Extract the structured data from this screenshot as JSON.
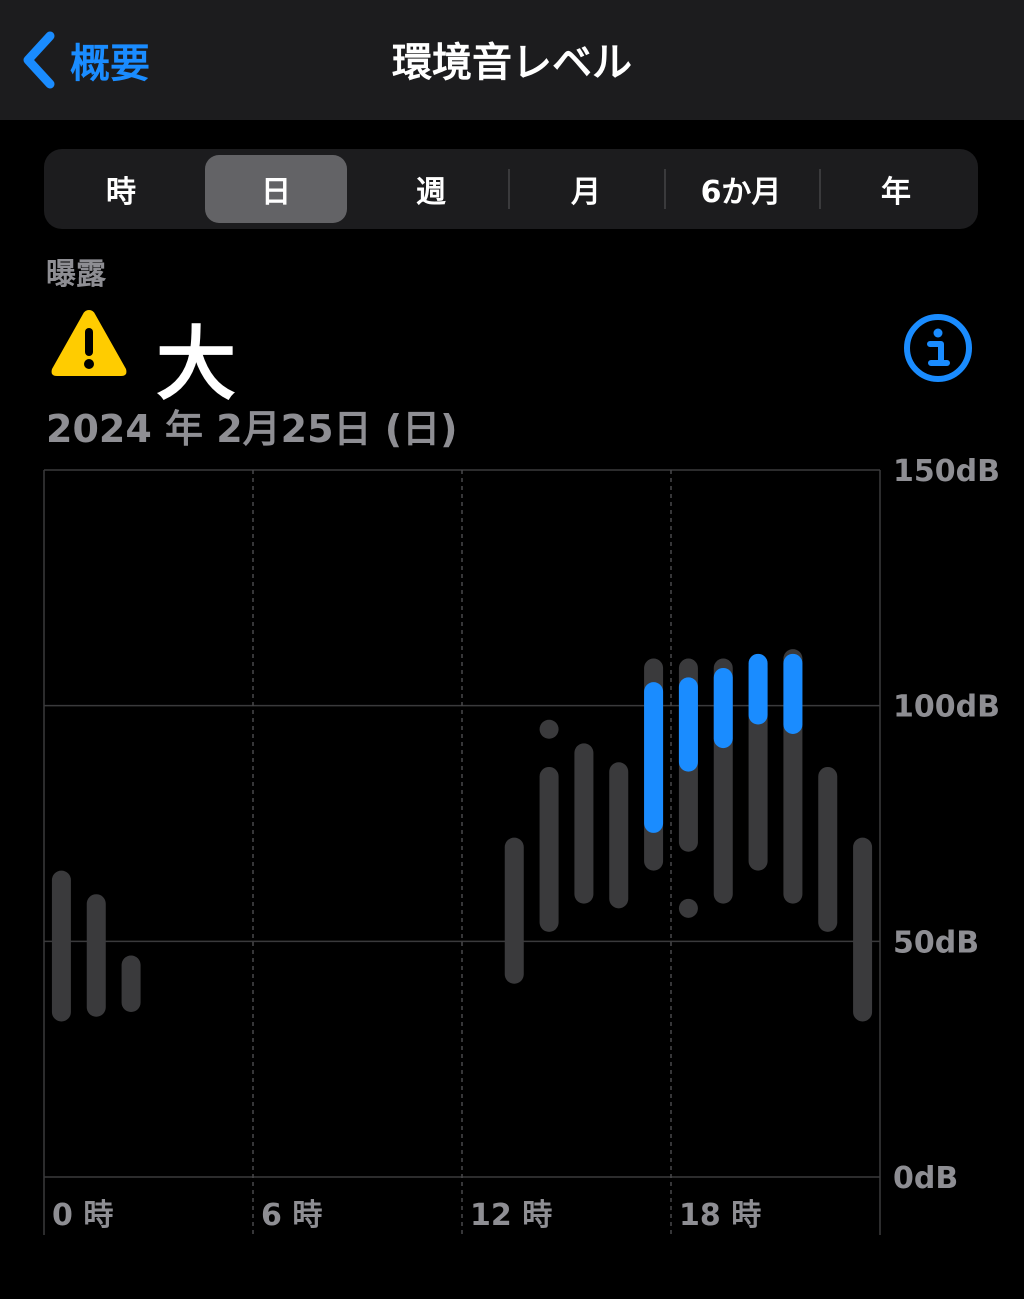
{
  "nav": {
    "back_label": "概要",
    "title": "環境音レベル"
  },
  "segments": {
    "items": [
      "時",
      "日",
      "週",
      "月",
      "6か月",
      "年"
    ],
    "selected": "日"
  },
  "exposure": {
    "label": "曝露",
    "value": "大",
    "warning_icon": "warning-triangle-icon",
    "info_icon": "info-circle-icon",
    "warning_color": "#ffcc00",
    "accent_color": "#1a8cff"
  },
  "date": "2024 年 2月25日 (日)",
  "chart_data": {
    "type": "range-bar",
    "title": "",
    "xlabel": "",
    "ylabel": "",
    "x_tick_labels": [
      "0 時",
      "6 時",
      "12 時",
      "18 時"
    ],
    "y_tick_labels": [
      "150dB",
      "100dB",
      "50dB",
      "0dB"
    ],
    "ylim": [
      0,
      150
    ],
    "xlim": [
      0,
      24
    ],
    "grid": true,
    "colors": {
      "range": "#3a3a3c",
      "highlight": "#1a8cff"
    },
    "series": [
      {
        "values": [
          {
            "hour": 0,
            "min": 33,
            "max": 65
          },
          {
            "hour": 1,
            "min": 34,
            "max": 60
          },
          {
            "hour": 2,
            "min": 35,
            "max": 47
          },
          {
            "hour": 13,
            "min": 41,
            "max": 72
          },
          {
            "hour": 14,
            "min": 52,
            "max": 87
          },
          {
            "hour": 14,
            "min": 94,
            "max": 96
          },
          {
            "hour": 15,
            "min": 58,
            "max": 92
          },
          {
            "hour": 16,
            "min": 57,
            "max": 88
          },
          {
            "hour": 17,
            "min": 65,
            "max": 110
          },
          {
            "hour": 18,
            "min": 69,
            "max": 110
          },
          {
            "hour": 18,
            "min": 56,
            "max": 58
          },
          {
            "hour": 19,
            "min": 58,
            "max": 110
          },
          {
            "hour": 20,
            "min": 65,
            "max": 110
          },
          {
            "hour": 21,
            "min": 58,
            "max": 112
          },
          {
            "hour": 22,
            "min": 52,
            "max": 87
          },
          {
            "hour": 23,
            "min": 33,
            "max": 72
          }
        ]
      },
      {
        "values": [
          {
            "hour": 17,
            "min": 73,
            "max": 105
          },
          {
            "hour": 18,
            "min": 86,
            "max": 106
          },
          {
            "hour": 19,
            "min": 91,
            "max": 108
          },
          {
            "hour": 20,
            "min": 96,
            "max": 111
          },
          {
            "hour": 21,
            "min": 94,
            "max": 111
          }
        ]
      }
    ]
  }
}
